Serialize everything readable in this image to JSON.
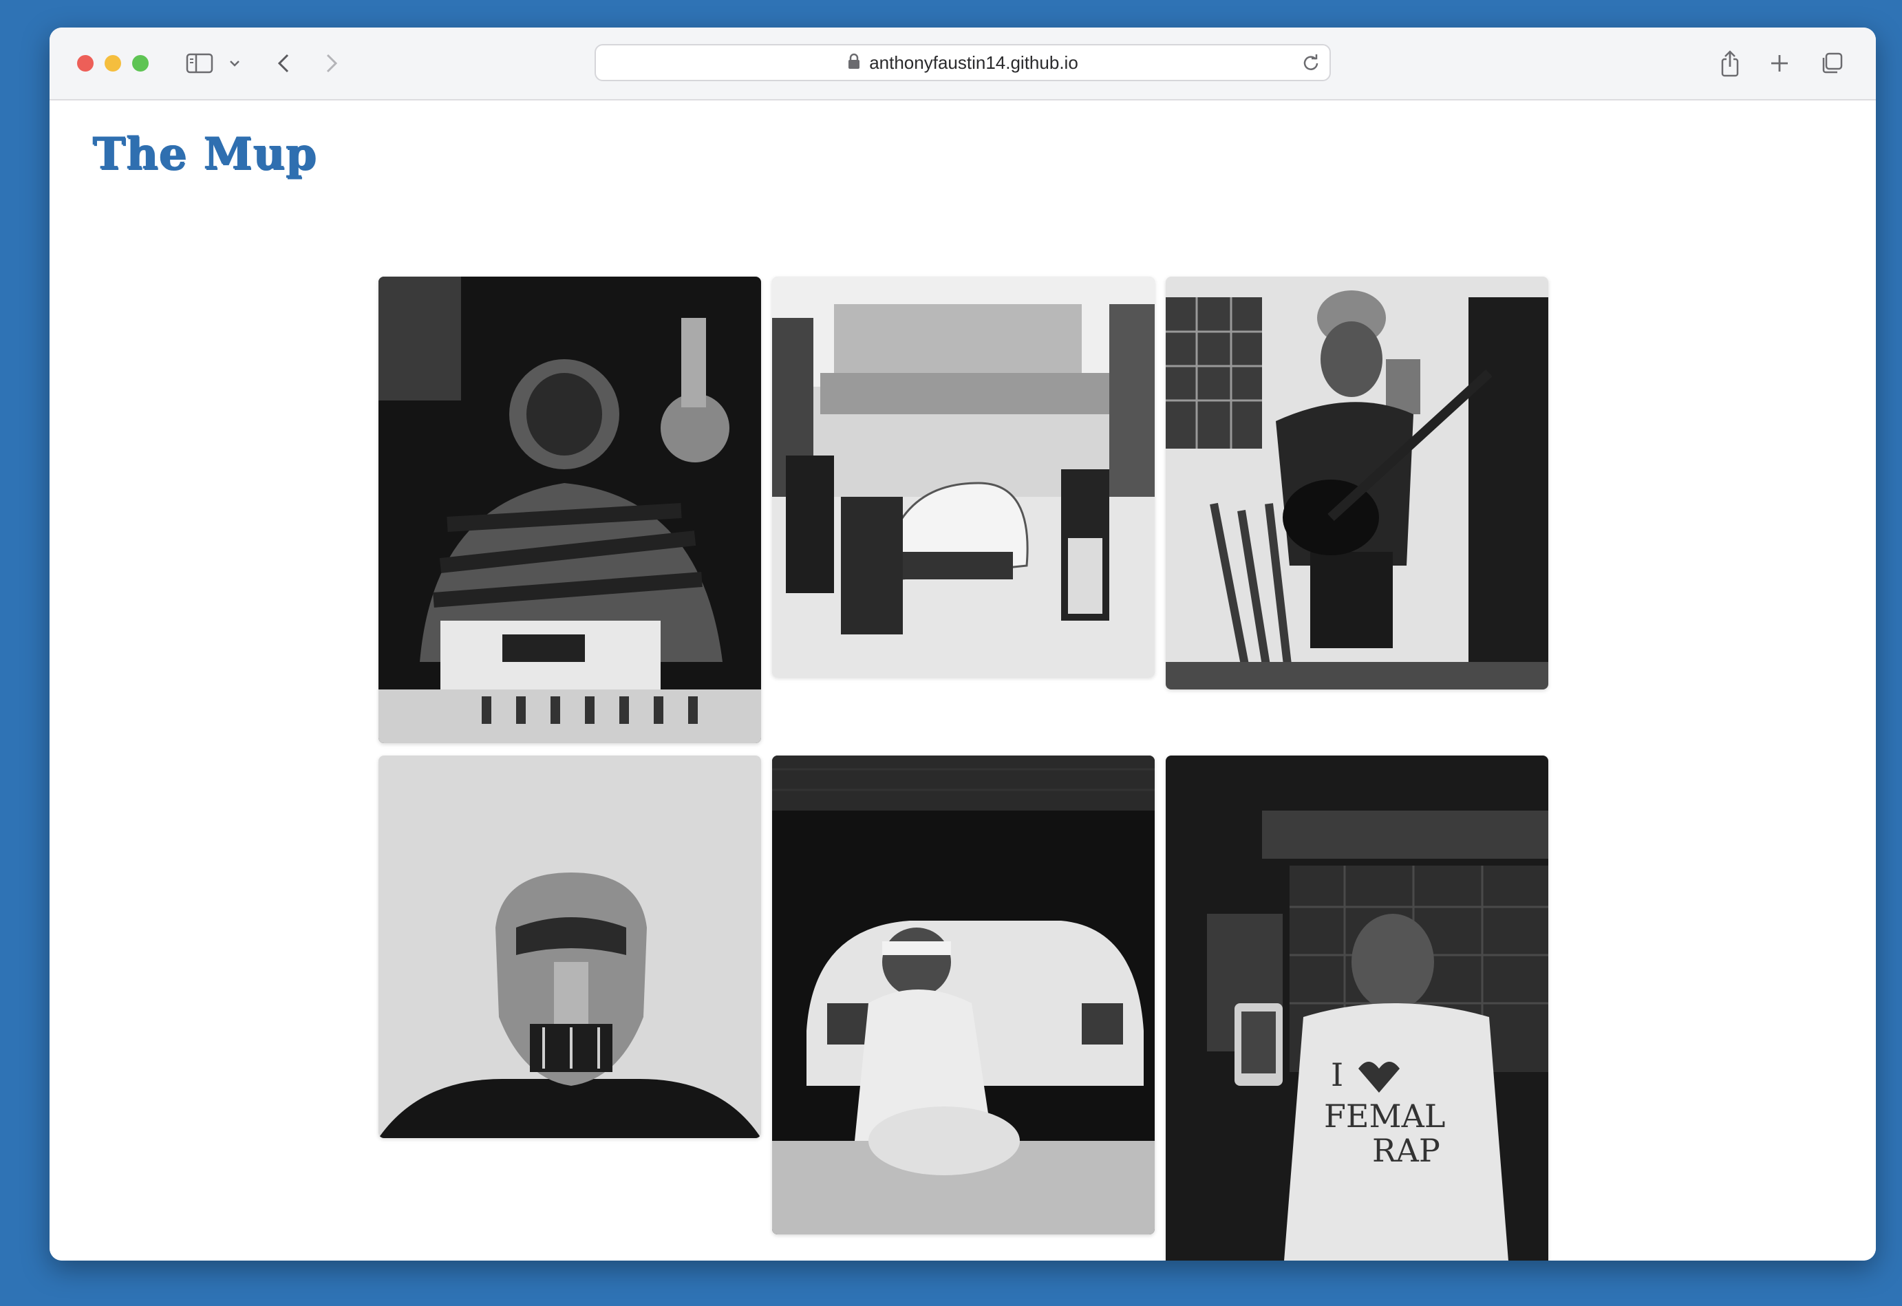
{
  "browser": {
    "url": "anthonyfaustin14.github.io"
  },
  "site": {
    "title": "The Mup"
  },
  "gallery": {
    "photos": [
      {
        "label": "photo-studio-producer"
      },
      {
        "label": "photo-dodge-street"
      },
      {
        "label": "photo-guitar-room"
      },
      {
        "label": "photo-metal-mask"
      },
      {
        "label": "photo-garage-car"
      },
      {
        "label": "photo-tshirt-phone"
      }
    ]
  }
}
